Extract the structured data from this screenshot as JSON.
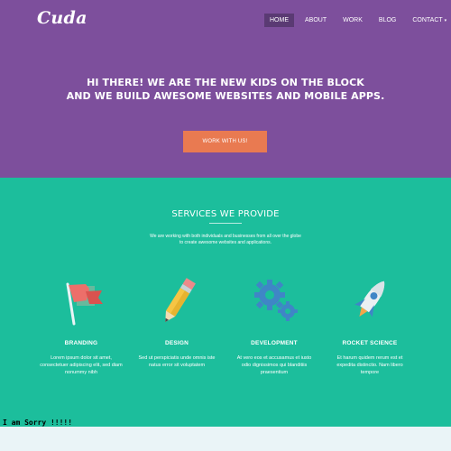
{
  "brand": {
    "logo": "Cuda"
  },
  "nav": {
    "items": [
      {
        "label": "HOME"
      },
      {
        "label": "ABOUT"
      },
      {
        "label": "WORK"
      },
      {
        "label": "BLOG"
      },
      {
        "label": "CONTACT"
      }
    ],
    "contact_caret": "▾"
  },
  "hero": {
    "line1": "HI THERE! WE ARE THE NEW KIDS ON THE BLOCK",
    "line2": "AND WE BUILD AWESOME WEBSITES AND MOBILE APPS.",
    "cta_label": "WORK WITH US!"
  },
  "services": {
    "title": "SERVICES WE PROVIDE",
    "subtitle_line1": "We are working with both individuals and businesses from all over the globe",
    "subtitle_line2": "to create awesome websites and applications.",
    "cards": [
      {
        "title": "BRANDING",
        "text": "Lorem ipsum dolor sit amet, consectetuer adipiscing elit, sed diam nonummy nibh",
        "icon": "flag-icon"
      },
      {
        "title": "DESIGN",
        "text": "Sed ut perspiciatis unde omnis iste natus error sit voluptatem",
        "icon": "pencil-icon"
      },
      {
        "title": "DEVELOPMENT",
        "text": "At vero eos et accusamus et iusto odio dignissimos qui blanditiis praesentium",
        "icon": "gears-icon"
      },
      {
        "title": "ROCKET SCIENCE",
        "text": "Et harum quidem rerum est et expedita distinctio. Nam libero tempore",
        "icon": "rocket-icon"
      }
    ]
  },
  "footer_note": "I am Sorry !!!!!",
  "colors": {
    "hero_bg": "#7d4f9c",
    "nav_active_bg": "#5a3a73",
    "cta": "#e97a51",
    "services_bg": "#1cbe9c"
  }
}
